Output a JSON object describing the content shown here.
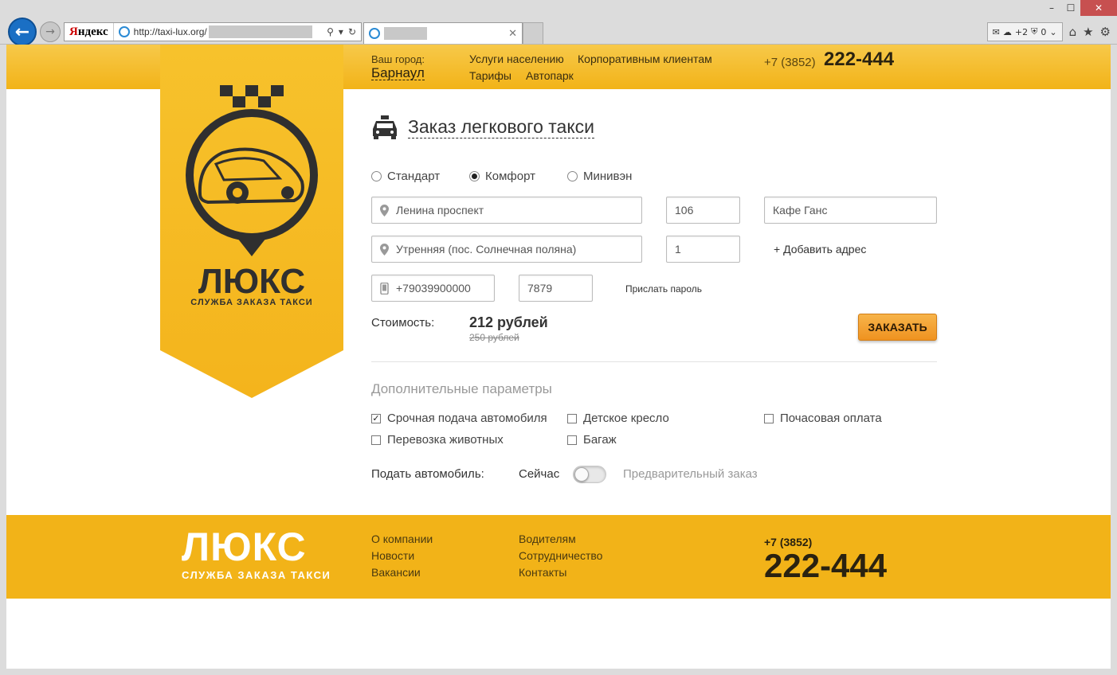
{
  "browser": {
    "search_brand_red": "Я",
    "search_brand_black": "ндекс",
    "url": "http://taxi-lux.org/",
    "ext_count_1": "+2",
    "ext_count_2": "0"
  },
  "header": {
    "city_label": "Ваш город:",
    "city_name": "Барнаул",
    "nav": [
      "Услуги населению",
      "Корпоративным клиентам",
      "Тарифы",
      "Автопарк"
    ],
    "phone_code": "+7 (3852)",
    "phone_number": "222-444"
  },
  "logo": {
    "main": "ЛЮКС",
    "sub": "СЛУЖБА ЗАКАЗА ТАКСИ"
  },
  "form": {
    "title": "Заказ легкового такси",
    "car_classes": [
      {
        "label": "Стандарт",
        "selected": false
      },
      {
        "label": "Комфорт",
        "selected": true
      },
      {
        "label": "Минивэн",
        "selected": false
      }
    ],
    "from_street": "Ленина проспект",
    "from_house": "106",
    "from_note": "Кафе Ганс",
    "to_street": "Утренняя (пос. Солнечная поляна)",
    "to_house": "1",
    "add_address": "+ Добавить адрес",
    "phone": "+79039900000",
    "password": "7879",
    "send_password": "Прислать пароль",
    "cost_label": "Стоимость:",
    "price": "212 рублей",
    "old_price": "250 рублей",
    "order_button": "ЗАКАЗАТЬ"
  },
  "extras": {
    "title": "Дополнительные параметры",
    "options": [
      {
        "label": "Срочная подача автомобиля",
        "checked": true
      },
      {
        "label": "Детское кресло",
        "checked": false
      },
      {
        "label": "Почасовая оплата",
        "checked": false
      },
      {
        "label": "Перевозка животных",
        "checked": false
      },
      {
        "label": "Багаж",
        "checked": false
      }
    ],
    "pickup_label": "Подать автомобиль:",
    "pickup_now": "Сейчас",
    "pickup_later": "Предварительный заказ"
  },
  "footer": {
    "links_col1": [
      "О компании",
      "Новости",
      "Вакансии"
    ],
    "links_col2": [
      "Водителям",
      "Сотрудничество",
      "Контакты"
    ],
    "phone_code": "+7 (3852)",
    "phone_number": "222-444"
  },
  "colors": {
    "brand_yellow": "#f2b318",
    "order_button": "#ef9220",
    "dark": "#333333"
  }
}
